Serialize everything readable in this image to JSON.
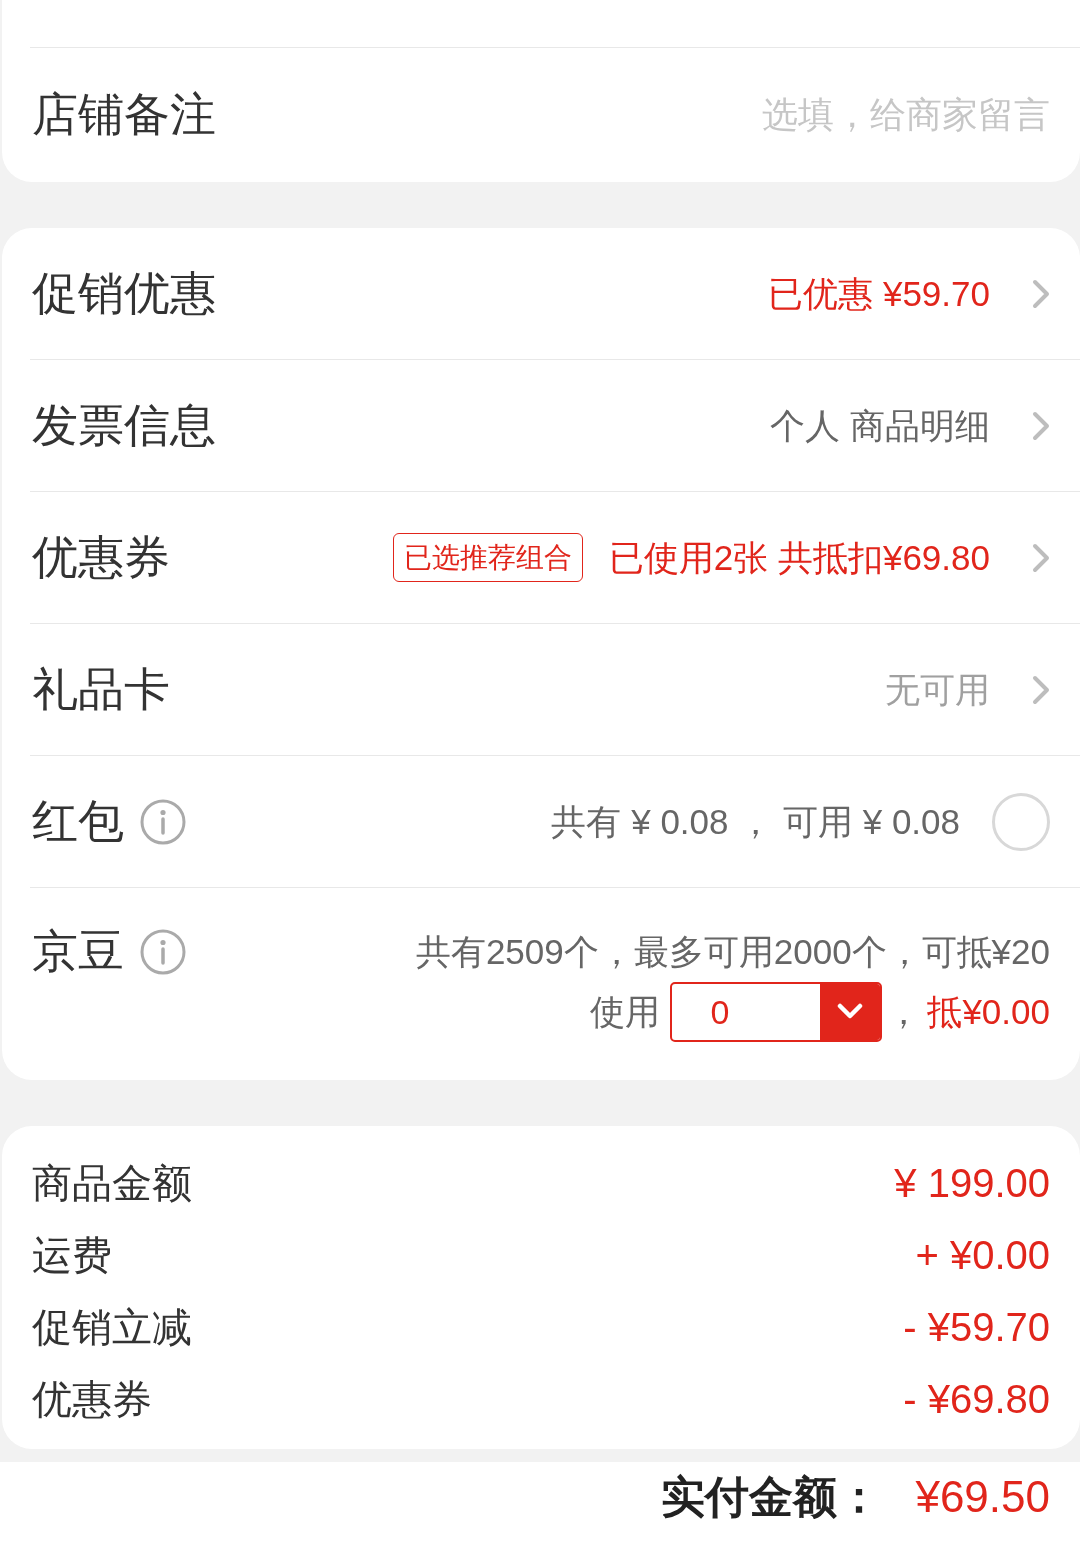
{
  "remark": {
    "label": "店铺备注",
    "placeholder": "选填，给商家留言"
  },
  "options": [
    {
      "kind": "link",
      "label": "促销优惠",
      "value": "已优惠 ¥59.70",
      "highlighted": true,
      "disabled": false
    },
    {
      "kind": "link",
      "label": "发票信息",
      "value": "个人 商品明细",
      "highlighted": false,
      "disabled": false
    },
    {
      "kind": "link",
      "label": "优惠券",
      "tag": "已选推荐组合",
      "value": "已使用2张 共抵扣¥69.80",
      "highlighted": true,
      "disabled": false
    },
    {
      "kind": "link",
      "label": "礼品卡",
      "value": "无可用",
      "highlighted": false,
      "disabled": true
    },
    {
      "kind": "toggle",
      "label": "红包",
      "value": "共有 ¥ 0.08 ， 可用 ¥ 0.08",
      "highlighted": false,
      "disabled": false,
      "checked": false
    },
    {
      "kind": "beans",
      "label": "京豆",
      "value": "共有2509个，最多可用2000个，可抵¥20",
      "highlighted": false,
      "disabled": false,
      "use_label": "使用",
      "amount": "0",
      "separator": "，",
      "deduction": "抵¥0.00"
    }
  ],
  "summary": [
    {
      "label": "商品金额",
      "value": "¥ 199.00"
    },
    {
      "label": "运费",
      "value": "+ ¥0.00"
    },
    {
      "label": "促销立减",
      "value": "- ¥59.70"
    },
    {
      "label": "优惠券",
      "value": "- ¥69.80"
    }
  ],
  "total": {
    "label": "实付金额：",
    "value": "¥69.50"
  }
}
